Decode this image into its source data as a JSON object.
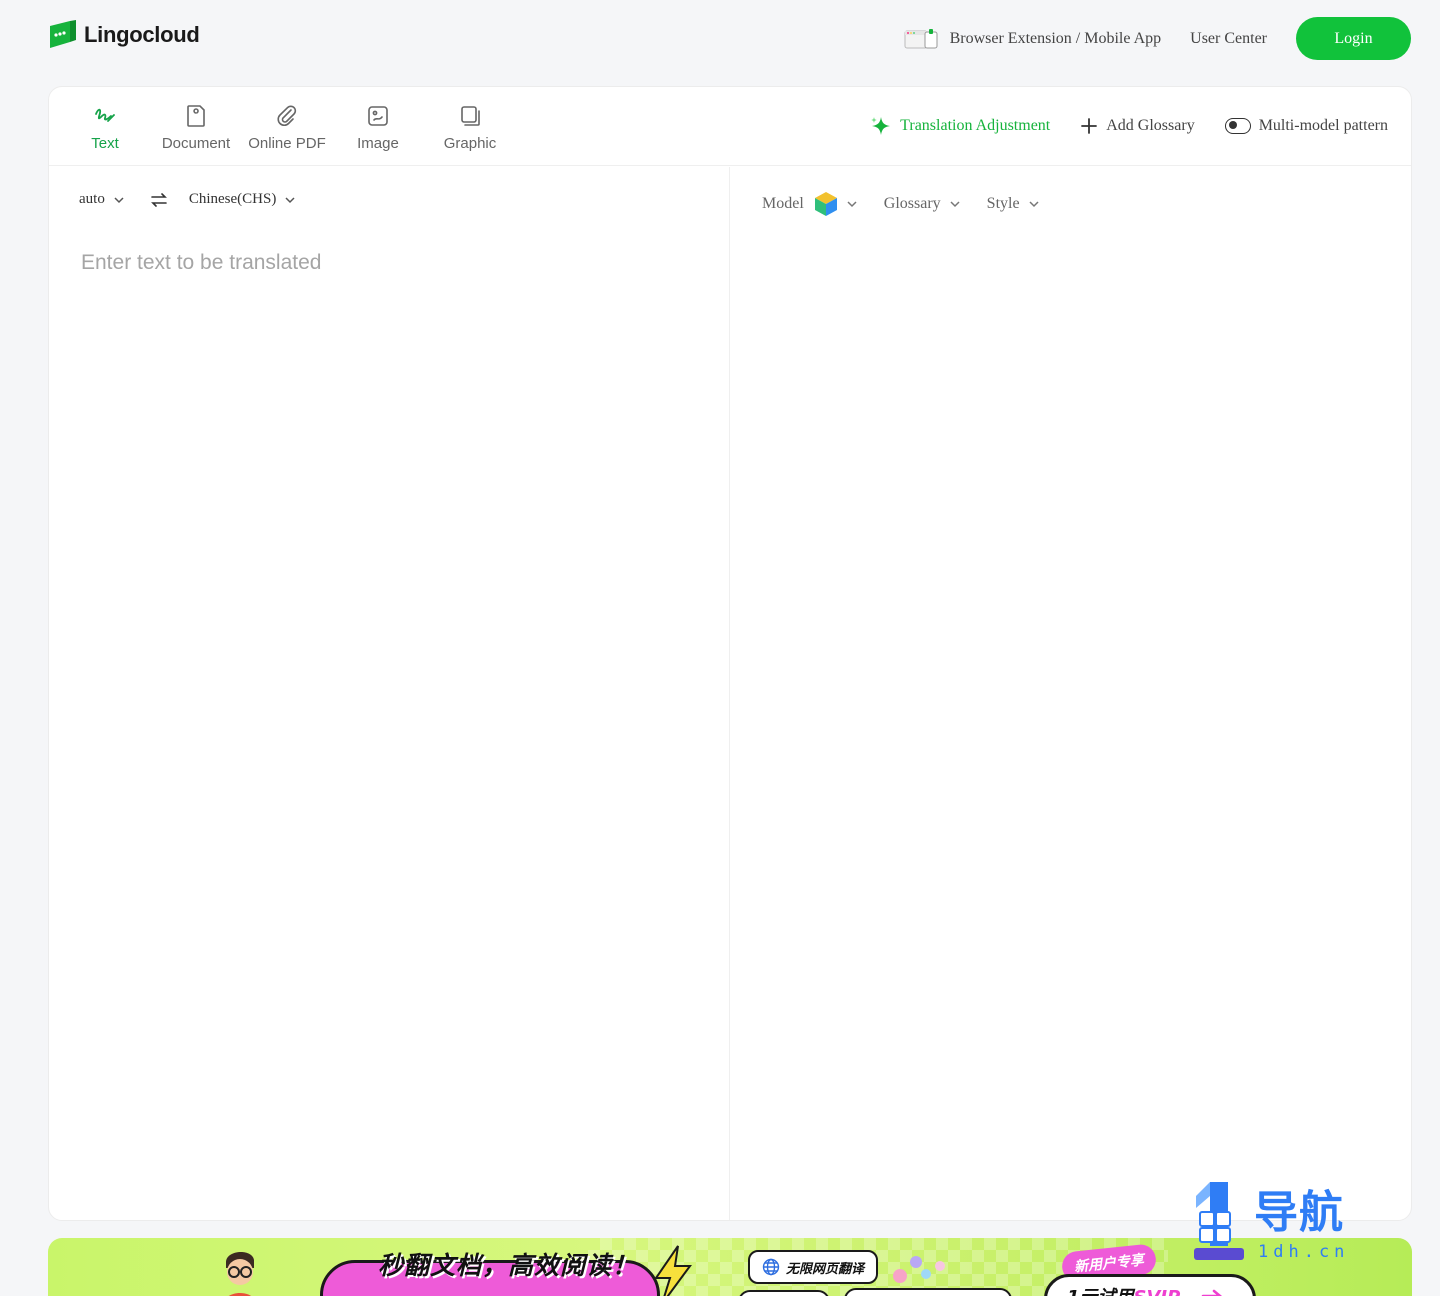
{
  "brand": {
    "name": "Lingocloud",
    "accent": "#11c23b"
  },
  "nav": {
    "extension_label": "Browser Extension / Mobile App",
    "user_center_label": "User Center",
    "login_label": "Login"
  },
  "tabs": [
    {
      "label": "Text",
      "icon": "pen-scribble-icon",
      "active": true
    },
    {
      "label": "Document",
      "icon": "document-icon",
      "active": false
    },
    {
      "label": "Online PDF",
      "icon": "paperclip-icon",
      "active": false
    },
    {
      "label": "Image",
      "icon": "image-icon",
      "active": false
    },
    {
      "label": "Graphic",
      "icon": "pages-icon",
      "active": false
    }
  ],
  "tools": {
    "adjustment_label": "Translation Adjustment",
    "glossary_label": "Add Glossary",
    "multimodel_label": "Multi-model pattern"
  },
  "source": {
    "from_lang": "auto",
    "to_lang": "Chinese(CHS)",
    "placeholder": "Enter text to be translated",
    "value": ""
  },
  "target": {
    "model_label": "Model",
    "glossary_label": "Glossary",
    "style_label": "Style"
  },
  "banner": {
    "headline": "秒翻文档，高效阅读！",
    "tag_web": "无限网页翻译",
    "tag_new_user": "新用户专享",
    "offer_prefix": "1元试用",
    "offer_highlight": "SVIP"
  },
  "watermark": {
    "title": "导航",
    "subtitle": "1dh.cn"
  }
}
